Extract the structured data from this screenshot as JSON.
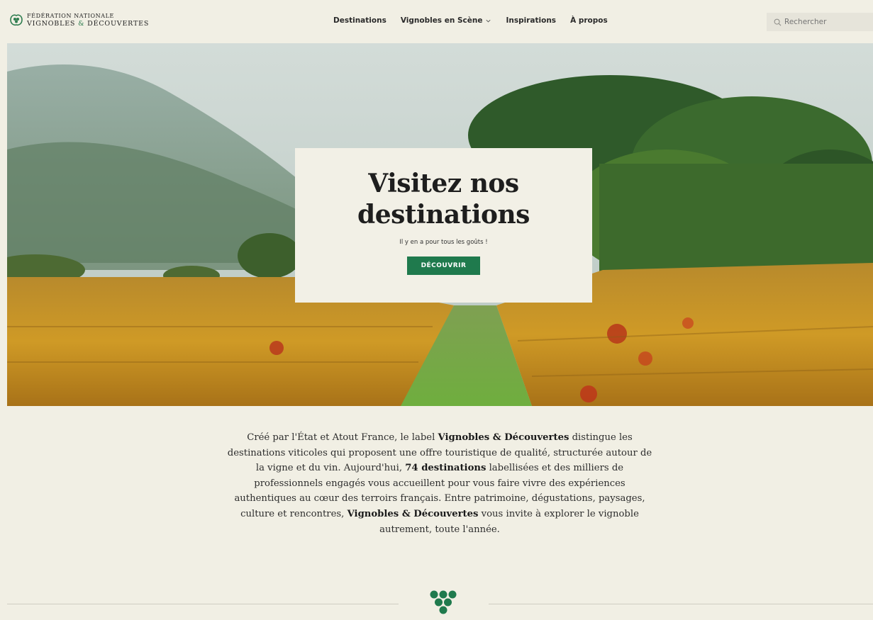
{
  "header": {
    "logo": {
      "line1": "Fédération nationale",
      "line2_a": "Vignobles",
      "line2_amp": "&",
      "line2_b": "Découvertes"
    },
    "nav": [
      {
        "label": "Destinations"
      },
      {
        "label": "Vignobles en Scène",
        "has_dropdown": true
      },
      {
        "label": "Inspirations"
      },
      {
        "label": "À propos"
      }
    ],
    "search": {
      "placeholder": "Rechercher"
    }
  },
  "hero": {
    "title_line1": "Visitez nos",
    "title_line2": "destinations",
    "subtitle": "Il y en a pour tous les goûts !",
    "cta_label": "DÉCOUVRIR"
  },
  "intro": {
    "p1": "Créé par l'État et Atout France, le label ",
    "b1": "Vignobles & Découvertes",
    "p2": " distingue les destinations viticoles qui proposent une offre touristique de qualité, structurée autour de la vigne et du vin. Aujourd'hui, ",
    "b2": "74 destinations",
    "p3": " labellisées et des milliers de professionnels engagés vous accueillent pour vous faire vivre des expériences authentiques au cœur des terroirs français. Entre patrimoine, dégustations, paysages, culture et rencontres, ",
    "b3": "Vignobles & Découvertes",
    "p4": " vous invite à explorer le vignoble autrement, toute l'année."
  },
  "colors": {
    "accent_green": "#1f7a4d",
    "background": "#f1efe4"
  }
}
